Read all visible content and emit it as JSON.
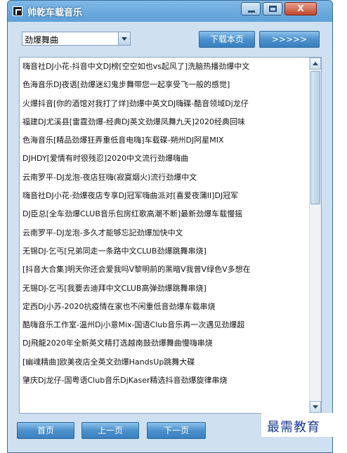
{
  "window": {
    "title": "帅乾车载音乐",
    "controls": {
      "minimize_icon": "minimize-icon",
      "maximize_icon": "maximize-icon",
      "close_label": "X"
    }
  },
  "toolbar": {
    "category_select": {
      "value": "劲爆舞曲"
    },
    "download_page_label": "下载本页",
    "next_arrows_label": ">>>>>"
  },
  "song_list": [
    "嗨音社DJ小花-抖音中文DJ榜[空空如也vs起风了]洗脑热播劲爆中文",
    "色海音乐DJ夜语[劲爆迷幻鬼步舞带您一起享受飞一般的感觉]",
    "火爆抖音[你的酒馆对我打了烊]劲爆中英文DJ嗨碟-酷音领域Dj龙仔",
    "福建DJ尤溪县[雷霆劲爆-经典DJ英文劲爆凤舞九天]2020经典回味",
    "色海音乐[精品劲爆狂弄重低音电嗨]车载碟-朔州DJ阿星MIX",
    "DJHDY[爱情有时很残忍]2020中文流行劲爆嗨曲",
    "云南罗平-DJ龙泡-夜店狂嗨(寂寞烟火)流行劲爆中文",
    "嗨音社DJ小花-劲爆夜店专享DJ冠军嗨曲派对[喜爱夜蒲II]DJ冠军",
    "DJ臣总[全车劲爆CLUB音乐包房红歌高潮不断]最新劲爆车载慢摇",
    "云南罗平-DJ龙泡-多久才能够忘記劲爆加快中文",
    "无锡DJ-乞丐[兄弟同走一条路中文CLUB劲爆跳舞串烧]",
    "[抖音大合集]明天你还会爱我吗V黎明前的黑暗V我曾V绿色V多想在",
    "无锡DJ-乞丐[我要去迪拜中文CLUB高弹劲爆跳舞串烧]",
    "定西Dj小苏-2020抗疫情在家也不闲重低音劲爆车载串烧",
    "酷嗨音乐工作室-温州Dj小意Mix-国语Club音乐再一次遇见劲爆超",
    "DJ飛龍2020年全新英文精打选越南鼓劲爆舞曲慢嗨串烧",
    "[幽魂精曲]欧美夜店全英文劲爆HandsUp跳舞大碟",
    "肇庆Dj龙仔-国粤语Club音乐DjKaser精选抖音劲爆旋律串烧"
  ],
  "pager": {
    "first_label": "首页",
    "prev_label": "上一页",
    "next_label": "下一页"
  },
  "watermark": "最需教育",
  "colors": {
    "title_bar": "#5d9fd6",
    "client_bg": "#cfe0f0",
    "button_blue": "#4c91cd",
    "watermark": "#1a3c8f"
  }
}
